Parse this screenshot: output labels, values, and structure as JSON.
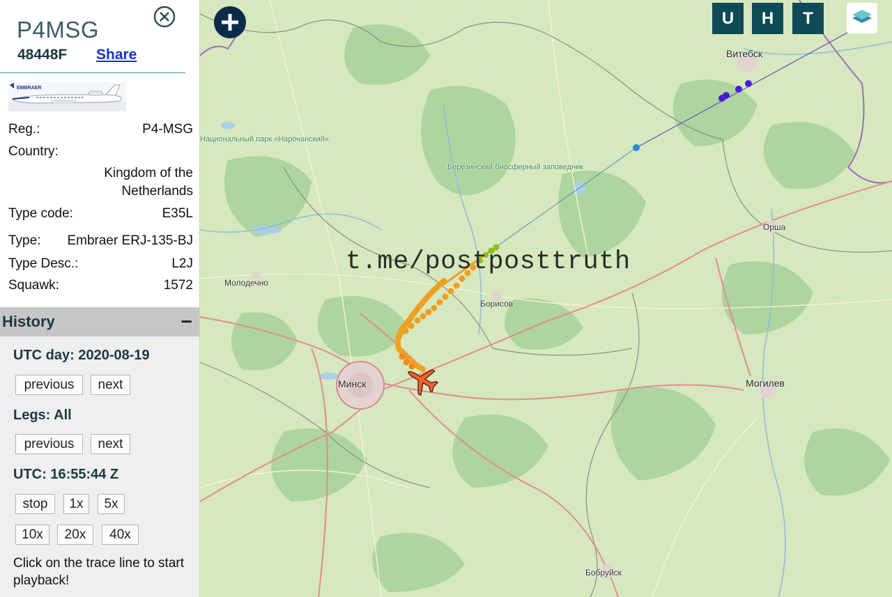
{
  "aircraft": {
    "callsign": "P4MSG",
    "hex": "48448F",
    "share_label": "Share",
    "photo_text": "EMBRAER",
    "details": [
      {
        "label": "Reg.:",
        "value": "P4-MSG"
      },
      {
        "label": "Country:",
        "value": ""
      },
      {
        "label": "",
        "value": "Kingdom of the"
      },
      {
        "label": "",
        "value": "Netherlands"
      },
      {
        "label": "Type code:",
        "value": "E35L"
      },
      {
        "label": "Type:",
        "value": "Embraer ERJ-135-BJ"
      },
      {
        "label": "Type Desc.:",
        "value": "L2J"
      },
      {
        "label": "Squawk:",
        "value": "1572"
      }
    ]
  },
  "history": {
    "title": "History",
    "collapse_symbol": "−",
    "day_label": "UTC day: 2020-08-19",
    "legs_label": "Legs: All",
    "utc_label": "UTC: 16:55:44 Z",
    "prev_label": "previous",
    "next_label": "next",
    "stop_label": "stop",
    "speeds": [
      "1x",
      "5x",
      "10x",
      "20x",
      "40x"
    ],
    "tip": "Click on the trace line to start playback!"
  },
  "map": {
    "buttons": {
      "u": "U",
      "h": "H",
      "t": "T"
    },
    "zoom_symbol": "+",
    "watermark": "t.me/postposttruth",
    "labels": {
      "vitebsk": "Витебск",
      "orsha": "Орша",
      "borisov": "Борисов",
      "minsk": "Минск",
      "mogilev": "Могилев",
      "molodechno": "Молодечно",
      "bobruisk": "Бобруйск",
      "park": "Национальный парк «Нарочанский»",
      "reserve": "Березинский биосферный заповедник"
    },
    "colors": {
      "panel_button": "#0e4b57",
      "trace_orange": "#f0a020",
      "trace_green": "#88c020",
      "trace_blue": "#2090e0",
      "trace_violet": "#4a1ed8",
      "plane": "#f0642a"
    }
  }
}
